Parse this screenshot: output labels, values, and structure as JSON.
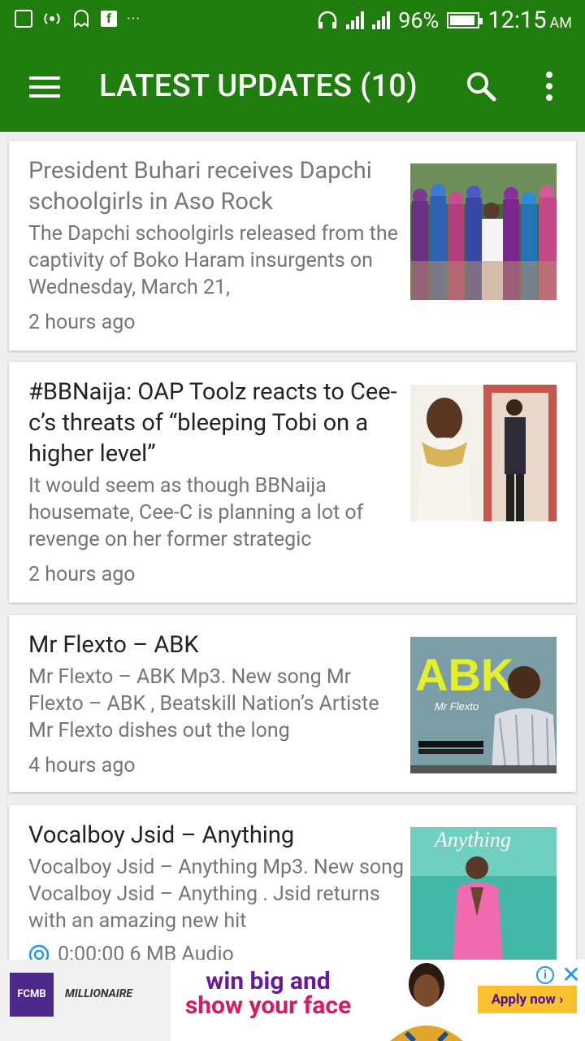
{
  "status_bar": {
    "battery": "96%",
    "time": "12:15",
    "ampm": "AM",
    "fb_glyph": "f",
    "dots": "···"
  },
  "app_bar": {
    "title": "LATEST UPDATES (10)"
  },
  "articles": [
    {
      "title": "President Buhari receives Dapchi schoolgirls in Aso Rock",
      "snippet": "The Dapchi schoolgirls released from the captivity of Boko Haram insurgents on Wednesday, March 21,",
      "time": "2 hours ago",
      "read": true
    },
    {
      "title": "#BBNaija: OAP Toolz reacts to Cee-c’s threats of “bleeping Tobi on a higher level”",
      "snippet": "It would seem as though BBNaija housemate, Cee-C is planning a lot of revenge on her former strategic",
      "time": "2 hours ago",
      "read": false
    },
    {
      "title": "Mr Flexto – ABK",
      "snippet": "Mr Flexto – ABK Mp3. New song Mr Flexto – ABK , Beatskill Nation’s Artiste Mr Flexto dishes out the long",
      "time": "4 hours ago",
      "read": false,
      "thumb_text": "ABK",
      "thumb_sub": "Mr Flexto"
    },
    {
      "title": "Vocalboy Jsid – Anything",
      "snippet": "Vocalboy Jsid – Anything Mp3. New song Vocalboy Jsid – Anything . Jsid returns with an amazing new hit",
      "audio": "0:00:00 6 MB Audio",
      "read": false,
      "thumb_text": "Anything"
    }
  ],
  "ad": {
    "logo": "FCMB",
    "brand": "MILLIONAIRE",
    "line1": "win big and",
    "line2": "show your face",
    "cta": "Apply now ›",
    "info": "i",
    "close": "✕"
  },
  "colors": {
    "primary": "#1e7d0c",
    "title_read": "#777777",
    "title_unread": "#222222",
    "snippet": "#757575"
  }
}
